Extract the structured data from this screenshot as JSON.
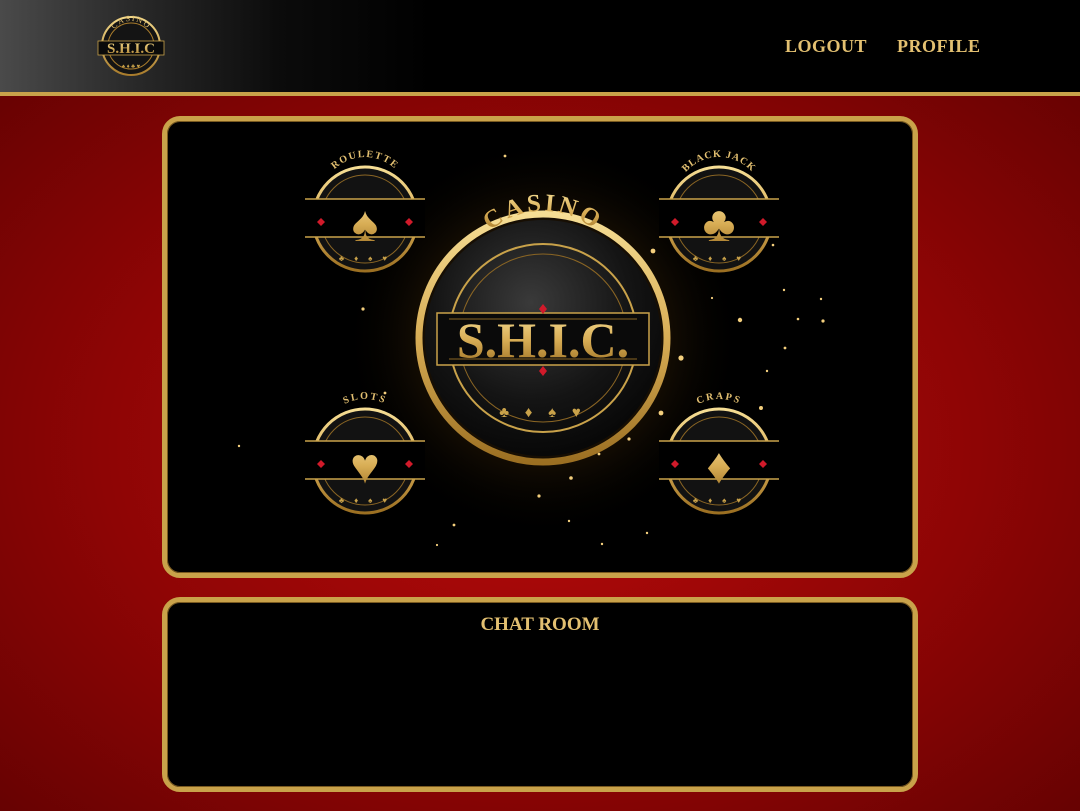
{
  "brand": {
    "small_logo_arc_text": "CASINO",
    "small_logo_name": "S.H.I.C",
    "main_logo_arc_text": "CASINO",
    "main_logo_name": "S.H.I.C."
  },
  "nav": {
    "logout_label": "LOGOUT",
    "profile_label": "PROFILE"
  },
  "games": [
    {
      "label": "ROULETTE",
      "icon": "spade-icon"
    },
    {
      "label": "BLACK JACK",
      "icon": "club-icon"
    },
    {
      "label": "SLOTS",
      "icon": "heart-icon"
    },
    {
      "label": "CRAPS",
      "icon": "diamond-icon"
    }
  ],
  "chat": {
    "title": "CHAT ROOM",
    "messages": []
  },
  "colors": {
    "gold": "#c9a24a",
    "gold_light": "#e3c071",
    "red_background": "#b80a0a",
    "black_panel": "#000000",
    "accent_red": "#d11a2a"
  }
}
